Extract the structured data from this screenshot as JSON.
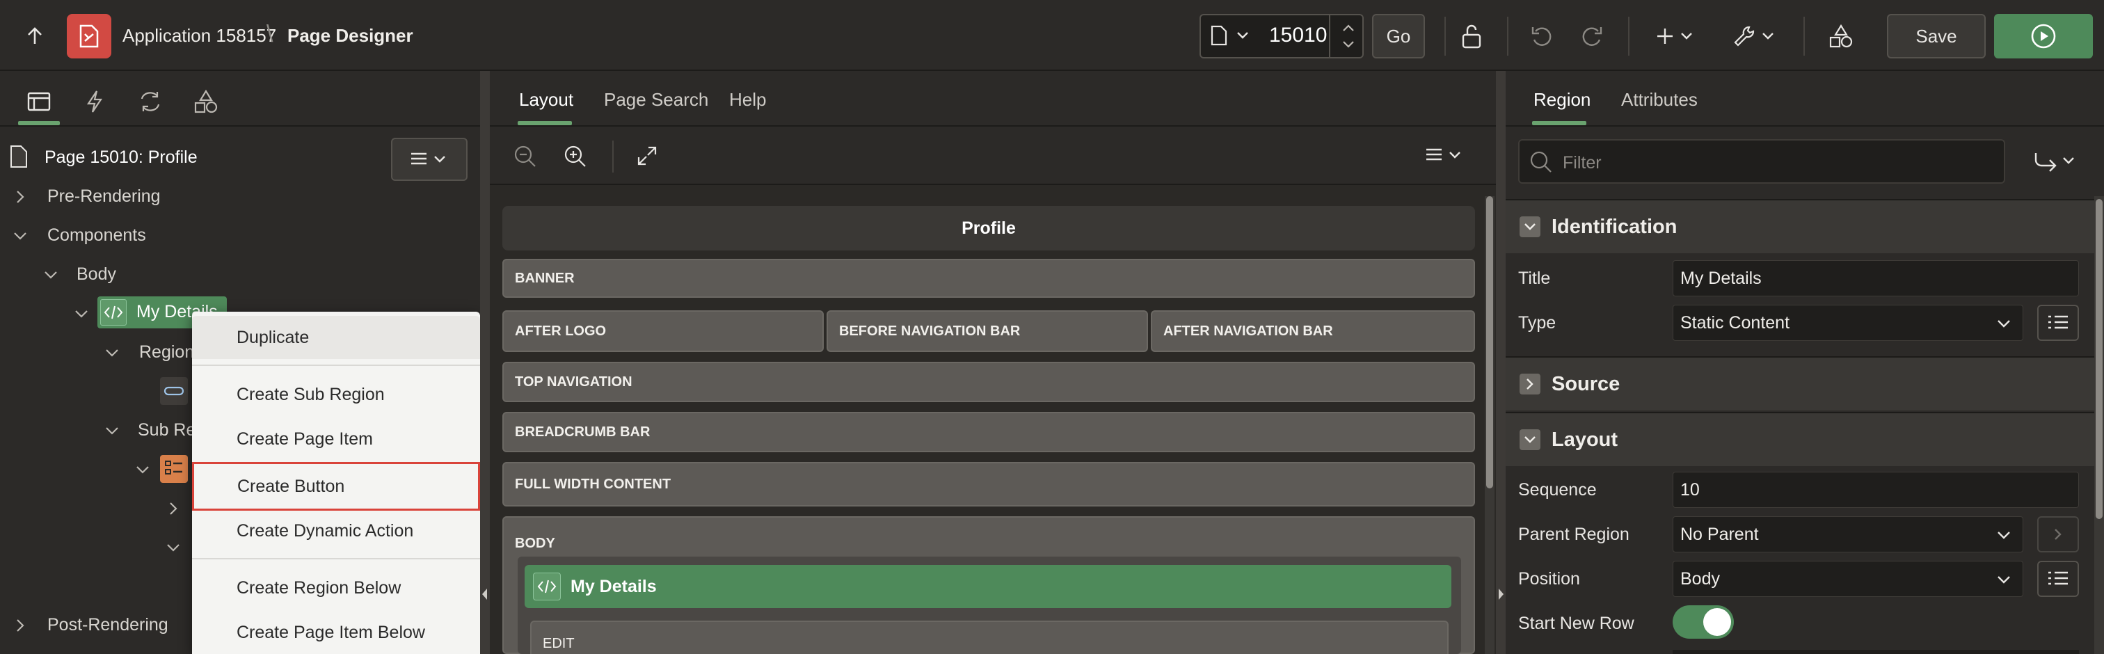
{
  "app": {
    "title": "Application 158157",
    "separator": "\\",
    "page": "Page Designer"
  },
  "toolbar": {
    "page_number": "15010",
    "go_label": "Go",
    "save_label": "Save"
  },
  "left_panel": {
    "page_label": "Page 15010: Profile",
    "tree": {
      "pre_rendering": "Pre-Rendering",
      "components": "Components",
      "body": "Body",
      "my_details": "My Details",
      "regions_partial": "Region",
      "sub_regions_partial": "Sub Re",
      "post_rendering": "Post-Rendering"
    }
  },
  "context_menu": {
    "items": [
      "Duplicate",
      "Create Sub Region",
      "Create Page Item",
      "Create Button",
      "Create Dynamic Action",
      "Create Region Below",
      "Create Page Item Below"
    ],
    "highlighted": "Create Button"
  },
  "center_panel": {
    "tabs": [
      "Layout",
      "Page Search",
      "Help"
    ],
    "active_tab": "Layout",
    "page_title_bar": "Profile",
    "zones": {
      "banner": "BANNER",
      "after_logo": "AFTER LOGO",
      "before_nav": "BEFORE NAVIGATION BAR",
      "after_nav": "AFTER NAVIGATION BAR",
      "top_nav": "TOP NAVIGATION",
      "breadcrumb": "BREADCRUMB BAR",
      "full_width": "FULL WIDTH CONTENT",
      "body": "BODY",
      "edit": "EDIT"
    },
    "region_name": "My Details"
  },
  "right_panel": {
    "tabs": [
      "Region",
      "Attributes"
    ],
    "active_tab": "Region",
    "filter_placeholder": "Filter",
    "sections": {
      "identification": "Identification",
      "source": "Source",
      "layout": "Layout"
    },
    "props": {
      "title_label": "Title",
      "title_value": "My Details",
      "type_label": "Type",
      "type_value": "Static Content",
      "sequence_label": "Sequence",
      "sequence_value": "10",
      "parent_label": "Parent Region",
      "parent_value": "No Parent",
      "position_label": "Position",
      "position_value": "Body",
      "start_row_label": "Start New Row"
    },
    "start_new_row_on": true
  },
  "colors": {
    "accent_green": "#4e8a5a",
    "app_red": "#d24a43",
    "highlight_border": "#d9433a"
  }
}
